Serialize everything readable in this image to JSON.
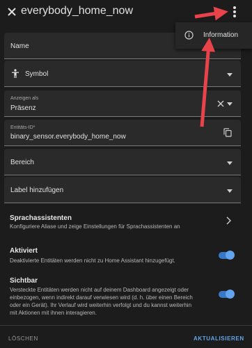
{
  "header": {
    "title": "everybody_home_now",
    "close_icon": "close-icon",
    "menu_icon": "more-vertical-icon"
  },
  "overflow_menu": {
    "items": [
      {
        "label": "Information",
        "icon": "info-icon"
      }
    ]
  },
  "form": {
    "name": {
      "placeholder": "Name"
    },
    "icon": {
      "label": "Symbol",
      "icon": "person-standing-icon"
    },
    "show_as": {
      "label": "Anzeigen als",
      "value": "Präsenz"
    },
    "entity_id": {
      "label": "Entitäts-ID*",
      "value": "binary_sensor.everybody_home_now"
    },
    "area": {
      "label": "Bereich"
    },
    "labels": {
      "label": "Label hinzufügen"
    }
  },
  "voice": {
    "title": "Sprachassistenten",
    "description": "Konfiguriere Aliase und zeige Einstellungen für Sprachassistenten an"
  },
  "enabled": {
    "title": "Aktiviert",
    "description": "Deaktivierte Entitäten werden nicht zu Home Assistant hinzugefügt.",
    "on": true
  },
  "visible": {
    "title": "Sichtbar",
    "description_1": "Versteckte Entitäten werden nicht auf deinem Dashboard angezeigt oder",
    "description_2": "einbezogen, wenn indirekt darauf verwiesen wird (d. h. über einen Bereich",
    "description_3": "oder ein Gerät). Ihr Verlauf wird weiterhin verfolgt und du kannst weiterhin",
    "description_4": "mit Aktionen mit ihnen interagieren.",
    "on": true
  },
  "footer": {
    "delete_label": "LÖSCHEN",
    "update_label": "AKTUALISIEREN"
  },
  "colors": {
    "accent": "#62a5ee",
    "annotation_arrow": "#e8434a",
    "background": "#1c1c1c"
  }
}
